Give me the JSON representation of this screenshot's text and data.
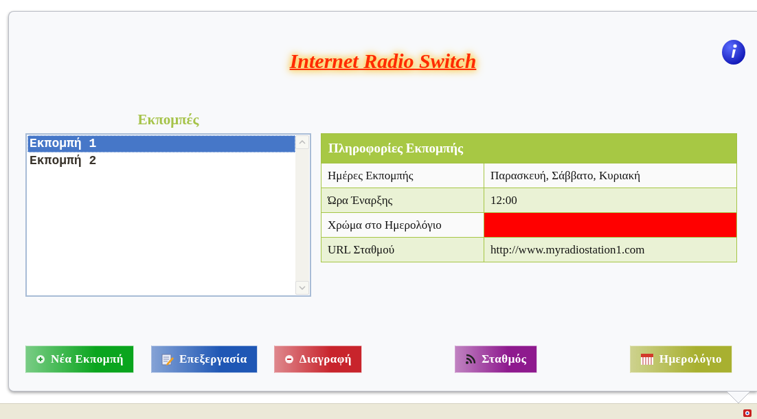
{
  "title": "Internet Radio Switch",
  "list": {
    "heading": "Εκπομπές",
    "items": [
      {
        "label": "Εκπομπή 1",
        "selected": true
      },
      {
        "label": "Εκπομπή 2",
        "selected": false
      }
    ]
  },
  "info_table": {
    "heading": "Πληροφορίες Εκπομπής",
    "rows": [
      {
        "kind": "text",
        "label": "Ημέρες Εκπομπής",
        "value": "Παρασκευή, Σάββατο, Κυριακή"
      },
      {
        "kind": "text",
        "label": "Ώρα Έναρξης",
        "value": "12:00"
      },
      {
        "kind": "swatch",
        "label": "Χρώμα στο Ημερολόγιο",
        "color": "#ff0000"
      },
      {
        "kind": "text",
        "label": "URL Σταθμού",
        "value": "http://www.myradiostation1.com"
      }
    ]
  },
  "buttons": [
    {
      "kind": "add",
      "label": "Νέα Εκπομπή",
      "color": "#0aa51e"
    },
    {
      "kind": "edit",
      "label": "Επεξεργασία",
      "color": "#1f57b5"
    },
    {
      "kind": "delete",
      "label": "Διαγραφή",
      "color": "#c8242c"
    },
    {
      "kind": "feed",
      "label": "Σταθμός",
      "color": "#8e1a8e"
    },
    {
      "kind": "calendar",
      "label": "Ημερολόγιο",
      "color": "#a8b030"
    }
  ]
}
